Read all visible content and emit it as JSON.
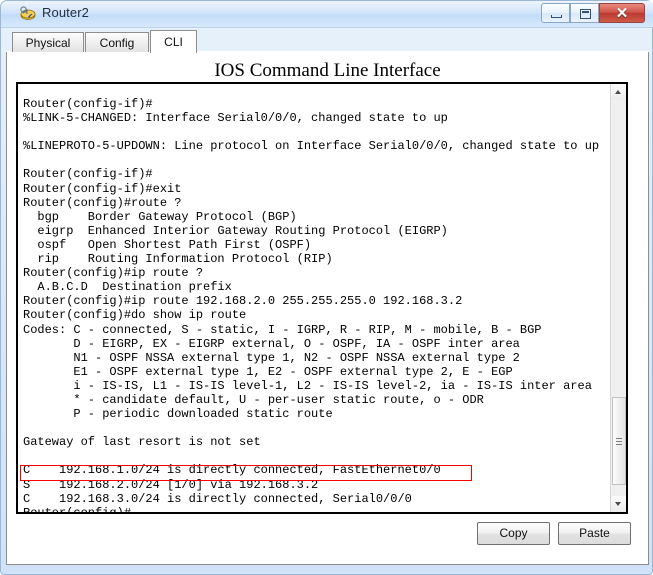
{
  "window": {
    "title": "Router2",
    "icon": "router-icon",
    "controls": {
      "minimize": "minimize-icon",
      "maximize": "maximize-icon",
      "close": "✕"
    }
  },
  "tabs": [
    {
      "label": "Physical",
      "active": false
    },
    {
      "label": "Config",
      "active": false
    },
    {
      "label": "CLI",
      "active": true
    }
  ],
  "panel": {
    "heading": "IOS Command Line Interface"
  },
  "terminal": {
    "lines": [
      "Router(config-if)#",
      "%LINK-5-CHANGED: Interface Serial0/0/0, changed state to up",
      "",
      "%LINEPROTO-5-UPDOWN: Line protocol on Interface Serial0/0/0, changed state to up",
      "",
      "Router(config-if)#",
      "Router(config-if)#exit",
      "Router(config)#route ?",
      "  bgp    Border Gateway Protocol (BGP)",
      "  eigrp  Enhanced Interior Gateway Routing Protocol (EIGRP)",
      "  ospf   Open Shortest Path First (OSPF)",
      "  rip    Routing Information Protocol (RIP)",
      "Router(config)#ip route ?",
      "  A.B.C.D  Destination prefix",
      "Router(config)#ip route 192.168.2.0 255.255.255.0 192.168.3.2",
      "Router(config)#do show ip route",
      "Codes: C - connected, S - static, I - IGRP, R - RIP, M - mobile, B - BGP",
      "       D - EIGRP, EX - EIGRP external, O - OSPF, IA - OSPF inter area",
      "       N1 - OSPF NSSA external type 1, N2 - OSPF NSSA external type 2",
      "       E1 - OSPF external type 1, E2 - OSPF external type 2, E - EGP",
      "       i - IS-IS, L1 - IS-IS level-1, L2 - IS-IS level-2, ia - IS-IS inter area",
      "       * - candidate default, U - per-user static route, o - ODR",
      "       P - periodic downloaded static route",
      "",
      "Gateway of last resort is not set",
      "",
      "C    192.168.1.0/24 is directly connected, FastEthernet0/0",
      "S    192.168.2.0/24 [1/0] via 192.168.3.2",
      "C    192.168.3.0/24 is directly connected, Serial0/0/0",
      "Router(config)#"
    ],
    "highlight": {
      "color": "#ff0000",
      "line_index": 27,
      "line_text": "S    192.168.2.0/24 [1/0] via 192.168.3.2"
    }
  },
  "scrollbar": {
    "up_arrow": "scroll-up-icon",
    "down_arrow": "scroll-down-icon",
    "position_percent": 78
  },
  "footer": {
    "copy_label": "Copy",
    "paste_label": "Paste"
  }
}
